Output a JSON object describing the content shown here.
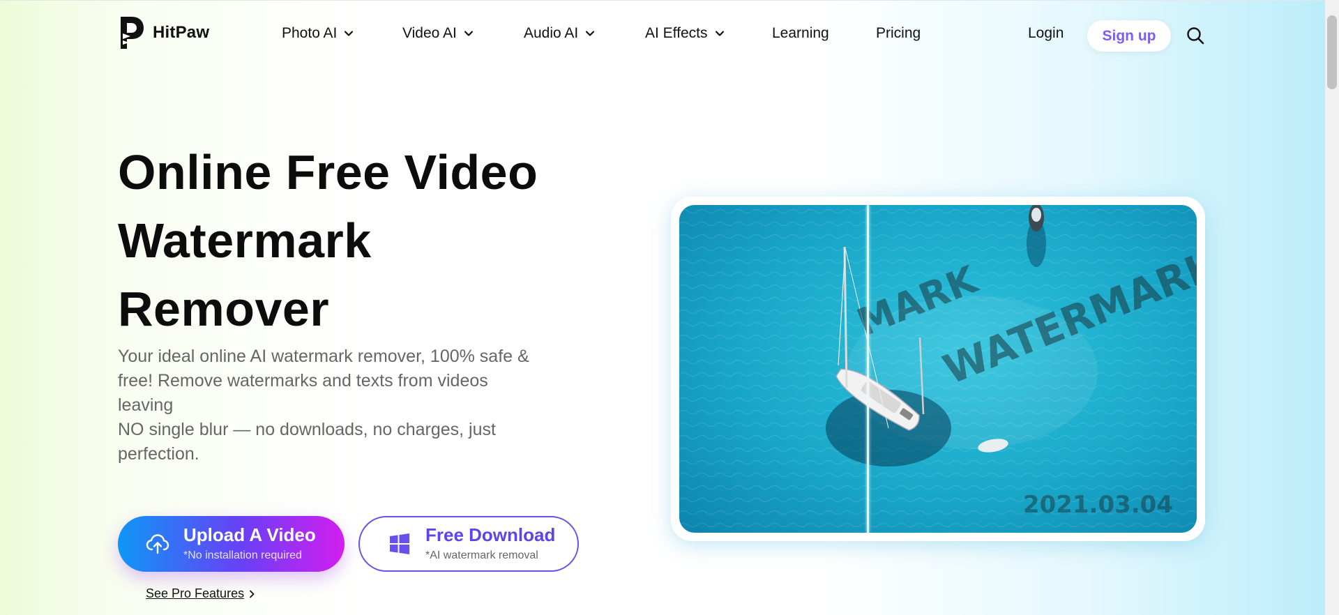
{
  "brand": {
    "name": "HitPaw"
  },
  "nav": {
    "items": [
      {
        "label": "Photo AI",
        "has_dropdown": true
      },
      {
        "label": "Video AI",
        "has_dropdown": true
      },
      {
        "label": "Audio AI",
        "has_dropdown": true
      },
      {
        "label": "AI Effects",
        "has_dropdown": true
      },
      {
        "label": "Learning",
        "has_dropdown": false
      },
      {
        "label": "Pricing",
        "has_dropdown": false
      }
    ],
    "login": "Login",
    "signup": "Sign up",
    "search_icon": "search-icon"
  },
  "hero": {
    "title_lines": [
      "Online Free Video",
      "Watermark",
      "Remover"
    ],
    "description_lines": [
      "Your ideal online AI watermark remover, 100% safe &",
      "free! Remove watermarks and texts from videos",
      "leaving",
      "NO single blur — no downloads, no charges, just",
      "perfection."
    ],
    "upload_button": {
      "label": "Upload A Video",
      "sublabel": "*No installation required",
      "icon": "cloud-upload-icon"
    },
    "download_button": {
      "label": "Free Download",
      "sublabel": "*AI watermark removal",
      "icon": "windows-icon"
    },
    "pro_link": "See Pro Features"
  },
  "preview": {
    "watermark_partial": "MARK",
    "watermark_text": "WATERMARK",
    "date_stamp": "2021.03.04"
  },
  "colors": {
    "accent": "#7d5bf6",
    "download_border": "#6a4ff0",
    "upload_gradient": [
      "#0e96f6",
      "#6a3ff5",
      "#d31ef0"
    ],
    "sea": "#1aa9c9"
  }
}
